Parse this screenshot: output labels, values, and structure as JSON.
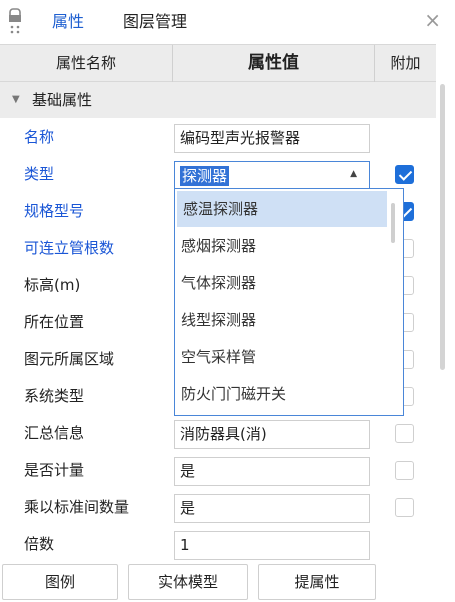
{
  "tabs": [
    {
      "label": "属性",
      "active": true
    },
    {
      "label": "图层管理",
      "active": false
    }
  ],
  "close_glyph": "×",
  "grid": {
    "col_name": "属性名称",
    "col_value": "属性值",
    "col_extra": "附加",
    "section_label": "基础属性",
    "rows": [
      {
        "name": "名称",
        "value": "编码型声光报警器",
        "checked": null
      },
      {
        "name": "类型",
        "value": "探测器",
        "checked": true
      },
      {
        "name": "规格型号",
        "value": "",
        "checked": true
      },
      {
        "name": "可连立管根数",
        "value": "",
        "checked": false
      },
      {
        "name": "标高(m)",
        "value": "",
        "checked": false
      },
      {
        "name": "所在位置",
        "value": "",
        "checked": false
      },
      {
        "name": "图元所属区域",
        "value": "",
        "checked": false
      },
      {
        "name": "系统类型",
        "value": "",
        "checked": false
      },
      {
        "name": "汇总信息",
        "value": "消防器具(消)",
        "checked": false
      },
      {
        "name": "是否计量",
        "value": "是",
        "checked": false
      },
      {
        "name": "乘以标准间数量",
        "value": "是",
        "checked": false
      },
      {
        "name": "倍数",
        "value": "1",
        "checked": null
      }
    ]
  },
  "dropdown": {
    "options": [
      "感温探测器",
      "感烟探测器",
      "气体探测器",
      "线型探测器",
      "空气采样管",
      "防火门门磁开关"
    ],
    "highlighted_index": 0
  },
  "footer": {
    "legend_label": "图例",
    "solid_model_label": "实体模型",
    "extract_attr_label": "提属性"
  },
  "colors": {
    "accent": "#1e6fd9",
    "label_blue": "#1a56d6",
    "header_bg": "#ececec"
  }
}
